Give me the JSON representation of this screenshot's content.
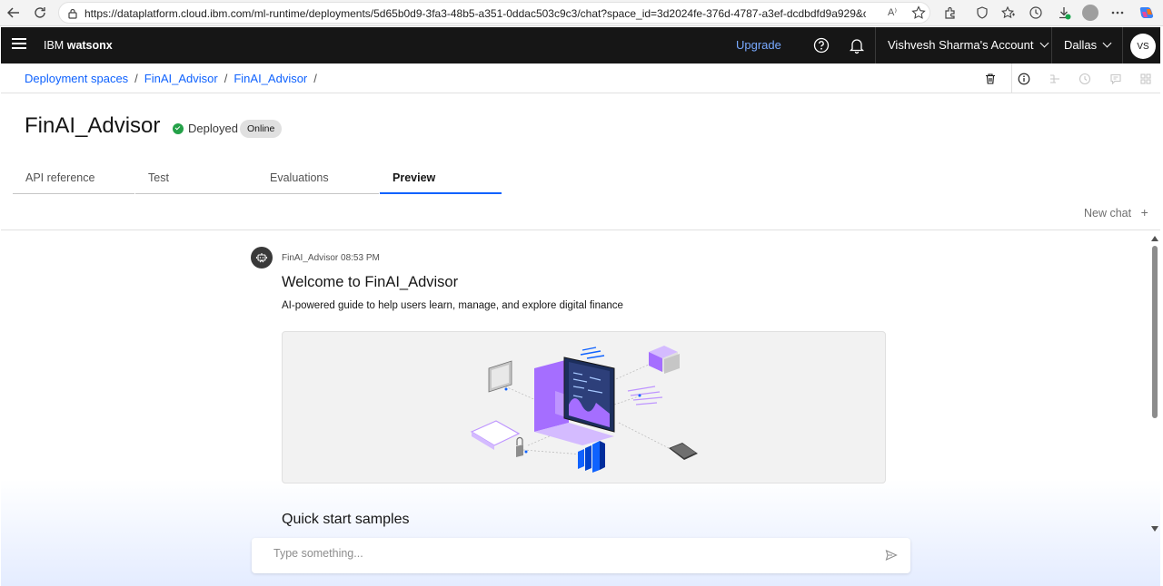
{
  "browser": {
    "url": "https://dataplatform.cloud.ibm.com/ml-runtime/deployments/5d65b0d9-3fa3-48b5-a351-0ddac503c9c3/chat?space_id=3d2024fe-376d-4787-a3ef-dcdbdfd9a929&con...",
    "read_aloud": "A⁾"
  },
  "header": {
    "brand_prefix": "IBM",
    "brand_name": "watsonx",
    "upgrade_label": "Upgrade",
    "account_label": "Vishvesh Sharma's Account",
    "region_label": "Dallas",
    "avatar_initials": "VS"
  },
  "breadcrumb": {
    "items": [
      "Deployment spaces",
      "FinAI_Advisor",
      "FinAI_Advisor"
    ],
    "separator": "/"
  },
  "deployment": {
    "name": "FinAI_Advisor",
    "status": "Deployed",
    "tag": "Online",
    "status_color": "#24a148"
  },
  "tabs": [
    {
      "label": "API reference",
      "active": false
    },
    {
      "label": "Test",
      "active": false
    },
    {
      "label": "Evaluations",
      "active": false
    },
    {
      "label": "Preview",
      "active": true
    }
  ],
  "chat": {
    "new_chat_label": "New chat",
    "new_chat_icon": "+",
    "sender": "FinAI_Advisor",
    "time": "08:53 PM",
    "welcome_title": "Welcome to FinAI_Advisor",
    "tagline": "AI-powered guide to help users learn, manage, and explore digital finance",
    "quick_start_title": "Quick start samples",
    "input_placeholder": "Type something..."
  },
  "colors": {
    "accent": "#0f62fe",
    "header_bg": "#161616",
    "upgrade_link": "#78a9ff",
    "illustration_purple": "#8a3ffc",
    "illustration_blue": "#0f62fe"
  }
}
